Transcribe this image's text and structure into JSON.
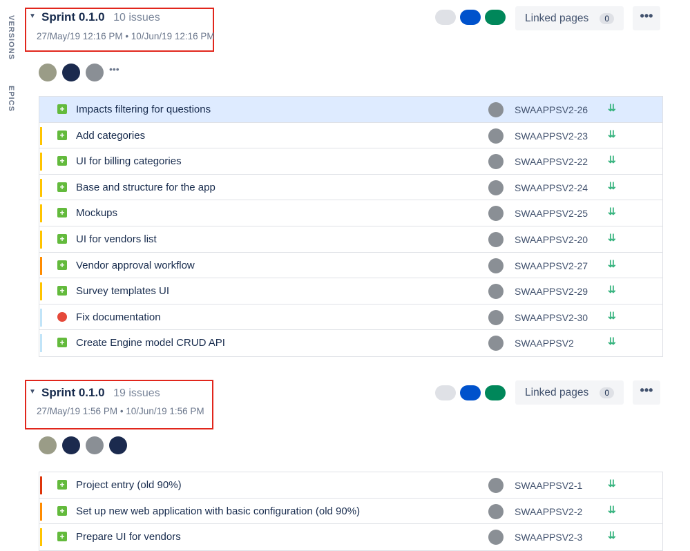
{
  "side_tabs": {
    "versions": "VERSIONS",
    "epics": "EPICS"
  },
  "colors": {
    "story": "#63ba3c",
    "bug": "#e5493a",
    "highlight": "#e1261c",
    "selected_row": "#deebff"
  },
  "sprints": [
    {
      "name": "Sprint 0.1.0",
      "count": "10 issues",
      "dates": "27/May/19 12:16 PM • 10/Jun/19 12:16 PM",
      "status_colors": [
        "#dfe1e6",
        "#0052cc",
        "#00875a"
      ],
      "linked_pages_label": "Linked pages",
      "linked_pages_count": "0",
      "more_label": "•••",
      "assignees": [
        "photo",
        "navy",
        "grey"
      ],
      "assignees_more": "•••",
      "issues": [
        {
          "type": "story",
          "icon": "story-icon",
          "summary": "Impacts filtering for questions",
          "key": "SWAAPPSV2-26",
          "epic_color": "#deebff",
          "priority": "lowest-icon",
          "selected": true
        },
        {
          "type": "story",
          "icon": "story-icon",
          "summary": "Add categories",
          "key": "SWAAPPSV2-23",
          "epic_color": "#ffc400",
          "priority": "lowest-icon",
          "selected": false
        },
        {
          "type": "story",
          "icon": "story-icon",
          "summary": "UI for billing categories",
          "key": "SWAAPPSV2-22",
          "epic_color": "#ffc400",
          "priority": "lowest-icon",
          "selected": false
        },
        {
          "type": "story",
          "icon": "story-icon",
          "summary": "Base and structure for the app",
          "key": "SWAAPPSV2-24",
          "epic_color": "#ffc400",
          "priority": "lowest-icon",
          "selected": false
        },
        {
          "type": "story",
          "icon": "story-icon",
          "summary": "Mockups",
          "key": "SWAAPPSV2-25",
          "epic_color": "#ffc400",
          "priority": "lowest-icon",
          "selected": false
        },
        {
          "type": "story",
          "icon": "story-icon",
          "summary": "UI for vendors list",
          "key": "SWAAPPSV2-20",
          "epic_color": "#ffc400",
          "priority": "lowest-icon",
          "selected": false
        },
        {
          "type": "story",
          "icon": "story-icon",
          "summary": "Vendor approval workflow",
          "key": "SWAAPPSV2-27",
          "epic_color": "#ff8b00",
          "priority": "lowest-icon",
          "selected": false
        },
        {
          "type": "story",
          "icon": "story-icon",
          "summary": "Survey templates UI",
          "key": "SWAAPPSV2-29",
          "epic_color": "#ffc400",
          "priority": "lowest-icon",
          "selected": false
        },
        {
          "type": "bug",
          "icon": "bug-icon",
          "summary": "Fix documentation",
          "key": "SWAAPPSV2-30",
          "epic_color": "#c1e4f8",
          "priority": "lowest-icon",
          "selected": false
        },
        {
          "type": "story",
          "icon": "story-icon",
          "summary": "Create Engine model CRUD API",
          "key": "SWAAPPSV2",
          "epic_color": "#c1e4f8",
          "priority": "lowest-icon",
          "selected": false
        }
      ]
    },
    {
      "name": "Sprint 0.1.0",
      "count": "19 issues",
      "dates": "27/May/19 1:56 PM • 10/Jun/19 1:56 PM",
      "status_colors": [
        "#dfe1e6",
        "#0052cc",
        "#00875a"
      ],
      "linked_pages_label": "Linked pages",
      "linked_pages_count": "0",
      "more_label": "•••",
      "assignees": [
        "photo",
        "navy",
        "grey",
        "navy"
      ],
      "assignees_more": "",
      "issues": [
        {
          "type": "story",
          "icon": "story-icon",
          "summary": "Project entry (old 90%)",
          "key": "SWAAPPSV2-1",
          "epic_color": "#de350b",
          "priority": "lowest-icon",
          "selected": false
        },
        {
          "type": "story",
          "icon": "story-icon",
          "summary": "Set up new web application with basic configuration (old 90%)",
          "key": "SWAAPPSV2-2",
          "epic_color": "#ff8b00",
          "priority": "lowest-icon",
          "selected": false
        },
        {
          "type": "story",
          "icon": "story-icon",
          "summary": "Prepare UI for vendors",
          "key": "SWAAPPSV2-3",
          "epic_color": "#ffc400",
          "priority": "lowest-icon",
          "selected": false
        }
      ]
    }
  ]
}
